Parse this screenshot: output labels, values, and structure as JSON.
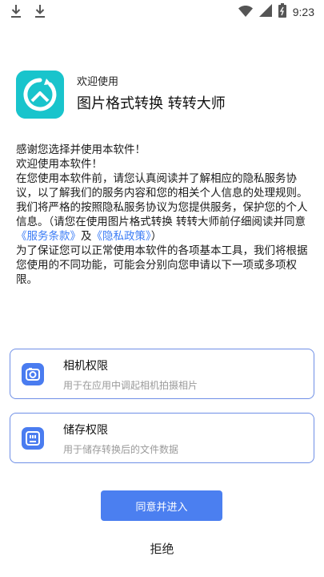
{
  "status_bar": {
    "time": "9:23",
    "left_icons": [
      "download-icon",
      "download-icon"
    ],
    "right_icons": [
      "wifi-icon",
      "signal-icon",
      "battery-icon"
    ]
  },
  "app": {
    "welcome": "欢迎使用",
    "name": "图片格式转换 转转大师",
    "brand_color": "#19c4cc"
  },
  "intro": {
    "line1": "感谢您选择并使用本软件！",
    "line2": "欢迎使用本软件！",
    "para1_prefix": "在您使用本软件前，请您认真阅读并了解相应的隐私服务协议，以了解我们的服务内容和您的相关个人信息的处理规则。我们将严格的按照隐私服务协议为您提供服务，保护您的个人信息。（请您在使用图片格式转换 转转大师前仔细阅读并同意",
    "terms_link": "《服务条款》",
    "and": "及",
    "privacy_link": "《隐私政策》",
    "para1_suffix": "）",
    "para2": "为了保证您可以正常使用本软件的各项基本工具，我们将根据您使用的不同功能，可能会分别向您申请以下一项或多项权限。"
  },
  "permissions": [
    {
      "title": "相机权限",
      "desc": "用于在应用中调起相机拍摄相片",
      "icon": "camera-icon"
    },
    {
      "title": "储存权限",
      "desc": "用于储存转换后的文件数据",
      "icon": "storage-icon"
    }
  ],
  "actions": {
    "agree": "同意并进入",
    "reject": "拒绝"
  },
  "colors": {
    "accent": "#4b7ff0",
    "link": "#3b7cf5",
    "card_border": "#6f8fe6"
  }
}
